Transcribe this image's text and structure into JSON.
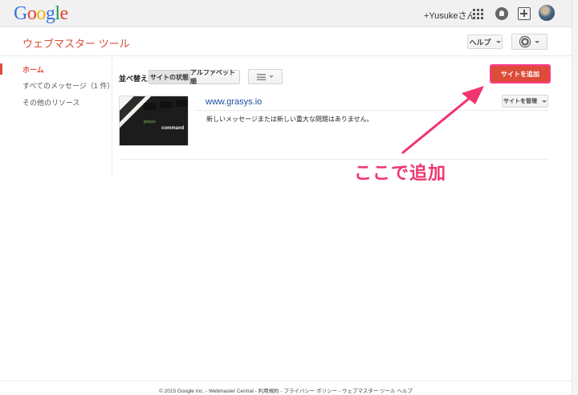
{
  "google_bar": {
    "logo": [
      "G",
      "o",
      "o",
      "g",
      "l",
      "e"
    ],
    "logo_colors": [
      "#3b73e4",
      "#e0422f",
      "#f4b400",
      "#3b73e4",
      "#1e9b4b",
      "#e0422f"
    ],
    "user_name": "+Yusukeさん",
    "icons": [
      "apps-grid-icon",
      "notifications-icon",
      "share-icon",
      "avatar"
    ]
  },
  "app": {
    "title": "ウェブマスター ツール",
    "help_label": "ヘルプ",
    "settings_icon": "gear-icon"
  },
  "sidebar": {
    "items": [
      {
        "label": "ホーム",
        "active": true
      },
      {
        "label": "すべてのメッセージ（1 件）",
        "active": false
      },
      {
        "label": "その他のリソース",
        "active": false
      }
    ]
  },
  "toolbar": {
    "sort_label": "並べ替え:",
    "sort_options": [
      "サイトの状態",
      "アルファベット順"
    ],
    "selected_sort": "サイトの状態",
    "view_icon": "list-view-icon",
    "add_site_label": "サイトを追加"
  },
  "sites": [
    {
      "url": "www.grasys.io",
      "message": "新しいメッセージまたは新しい重大な問題はありません。",
      "manage_label": "サイトを管理",
      "thumbnail_text": "command",
      "thumbnail_brand": "grasys"
    }
  ],
  "annotation": {
    "text": "ここで追加",
    "color": "#f0356e"
  },
  "footer": {
    "text": "© 2015 Google Inc. - Webmaster Central - 利用規約 - プライバシー ポリシー - ウェブマスター ツール ヘルプ"
  },
  "colors": {
    "accent": "#dd4b39",
    "link": "#1a4fa0"
  }
}
